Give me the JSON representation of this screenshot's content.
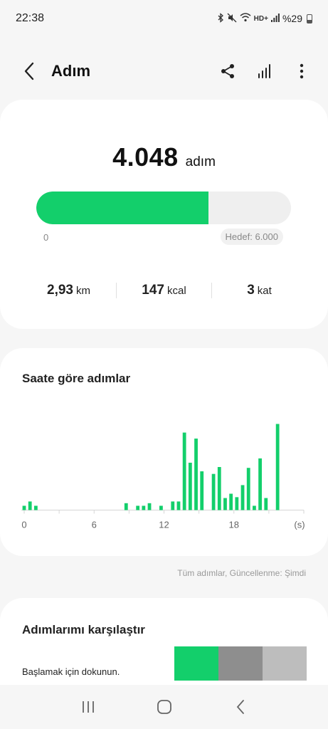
{
  "status_bar": {
    "time": "22:38",
    "battery": "%29",
    "net": "HD+",
    "icons": [
      "bluetooth-icon",
      "mute-icon",
      "wifi-icon",
      "signal-icon",
      "battery-icon"
    ]
  },
  "app_bar": {
    "title": "Adım",
    "icons": [
      "back-icon",
      "share-icon",
      "bar-chart-icon",
      "more-vertical-icon"
    ]
  },
  "summary": {
    "steps": "4.048",
    "unit": "adım",
    "progress_min": "0",
    "goal_label": "Hedef: 6.000",
    "progress_fraction": 0.675,
    "stats": [
      {
        "value": "2,93",
        "unit": "km"
      },
      {
        "value": "147",
        "unit": "kcal"
      },
      {
        "value": "3",
        "unit": "kat"
      }
    ],
    "accent_color": "#13cf6b"
  },
  "hourly": {
    "title": "Saate göre adımlar",
    "updated": "Tüm adımlar, Güncellenme: Şimdi"
  },
  "chart_data": {
    "type": "bar",
    "x_label_unit": "(s)",
    "x_ticks": [
      {
        "x": 0,
        "label": "0"
      },
      {
        "x": 6,
        "label": "6"
      },
      {
        "x": 12,
        "label": "12"
      },
      {
        "x": 18,
        "label": "18"
      }
    ],
    "xlim": [
      0,
      24
    ],
    "ylim": [
      0,
      1
    ],
    "bar_color": "#13cf6b",
    "grid": false,
    "x": [
      0.0,
      0.5,
      1.0,
      8.75,
      9.75,
      10.25,
      10.75,
      11.75,
      12.75,
      13.25,
      13.75,
      14.25,
      14.75,
      15.25,
      16.25,
      16.75,
      17.25,
      17.75,
      18.25,
      18.75,
      19.25,
      19.75,
      20.25,
      20.75,
      21.75
    ],
    "values": [
      0.05,
      0.1,
      0.05,
      0.08,
      0.05,
      0.05,
      0.08,
      0.05,
      0.1,
      0.1,
      0.9,
      0.55,
      0.83,
      0.45,
      0.42,
      0.5,
      0.14,
      0.19,
      0.15,
      0.29,
      0.49,
      0.05,
      0.6,
      0.14,
      1.0
    ]
  },
  "compare": {
    "title": "Adımlarımı karşılaştır",
    "desc": "Başlamak için dokunun.",
    "colors": [
      "#13cf6b",
      "#8e8e8e",
      "#bdbdbd"
    ]
  },
  "nav": {
    "icons": [
      "recents-icon",
      "home-icon",
      "back-nav-icon"
    ]
  }
}
